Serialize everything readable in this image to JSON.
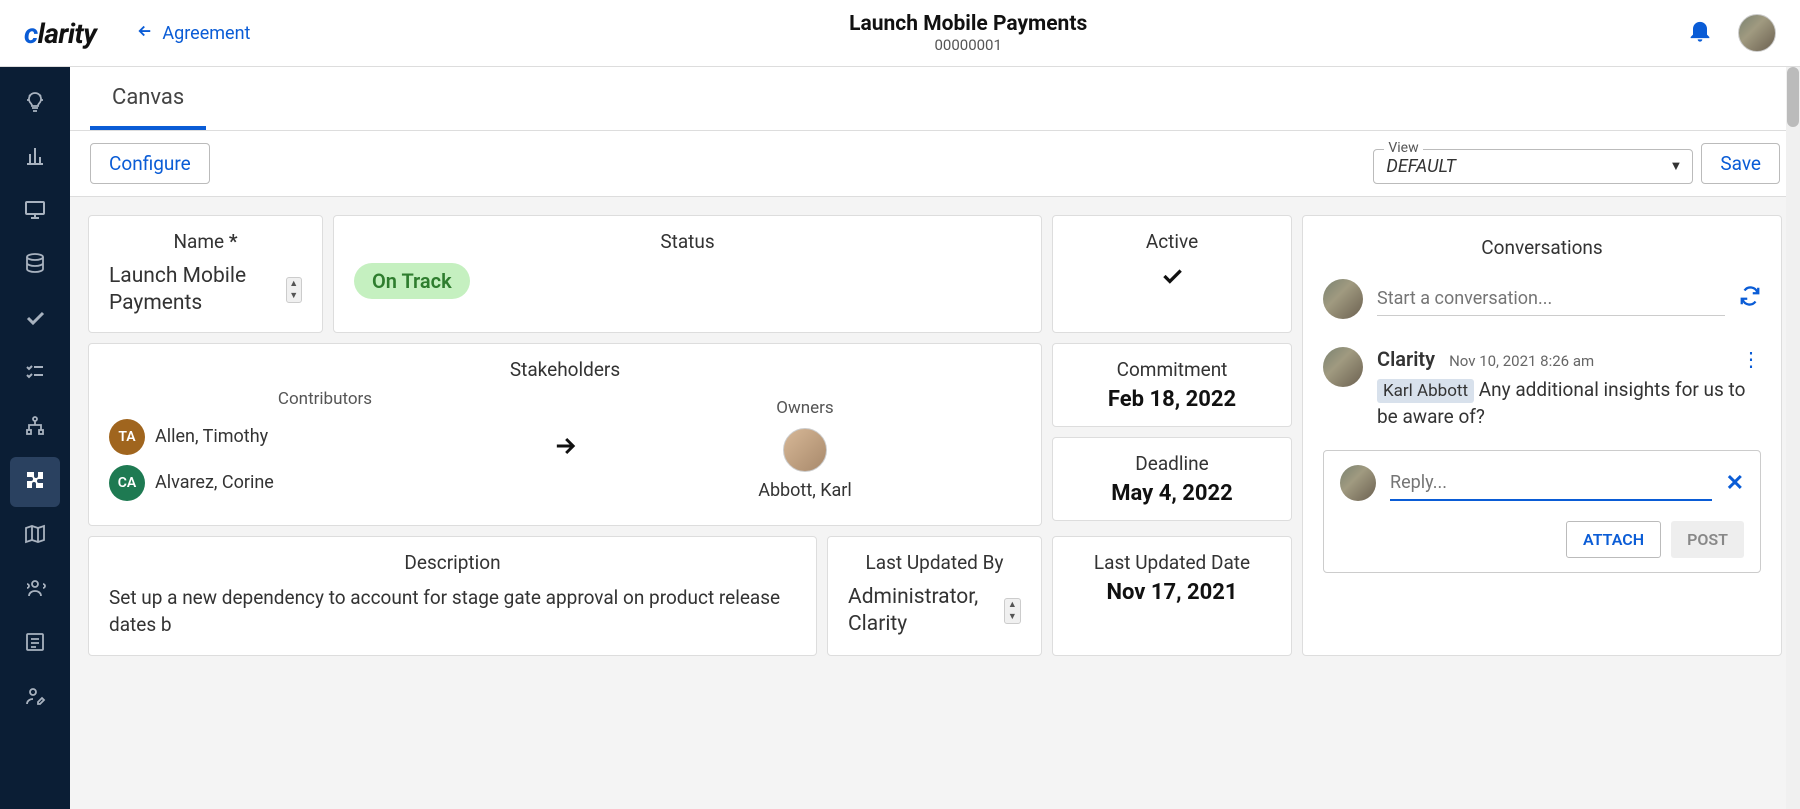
{
  "header": {
    "logo": "clarity",
    "back_label": "Agreement",
    "title": "Launch Mobile Payments",
    "subtitle": "00000001"
  },
  "tabs": {
    "canvas": "Canvas"
  },
  "actionbar": {
    "configure": "Configure",
    "view_label": "View",
    "view_value": "DEFAULT",
    "save": "Save"
  },
  "cards": {
    "name_label": "Name",
    "name_star": "*",
    "name_value": "Launch Mobile Payments",
    "status_label": "Status",
    "status_value": "On Track",
    "active_label": "Active",
    "stakeholders_label": "Stakeholders",
    "contributors_label": "Contributors",
    "owners_label": "Owners",
    "contributors": [
      {
        "initials": "TA",
        "name": "Allen, Timothy",
        "color": "ic-orange"
      },
      {
        "initials": "CA",
        "name": "Alvarez, Corine",
        "color": "ic-green"
      }
    ],
    "owner_name": "Abbott, Karl",
    "commitment_label": "Commitment",
    "commitment_value": "Feb 18, 2022",
    "deadline_label": "Deadline",
    "deadline_value": "May 4, 2022",
    "description_label": "Description",
    "description_value": "Set up a new dependency to account for stage gate approval on product release dates b",
    "updatedby_label": "Last Updated By",
    "updatedby_value": "Administrator, Clarity",
    "updateddate_label": "Last Updated Date",
    "updateddate_value": "Nov 17, 2021"
  },
  "conversations": {
    "title": "Conversations",
    "start_placeholder": "Start a conversation...",
    "message": {
      "author": "Clarity",
      "time": "Nov 10, 2021 8:26 am",
      "mention": "Karl Abbott",
      "text": " Any additional insights for us to be aware of?"
    },
    "reply_placeholder": "Reply...",
    "attach": "ATTACH",
    "post": "POST"
  }
}
